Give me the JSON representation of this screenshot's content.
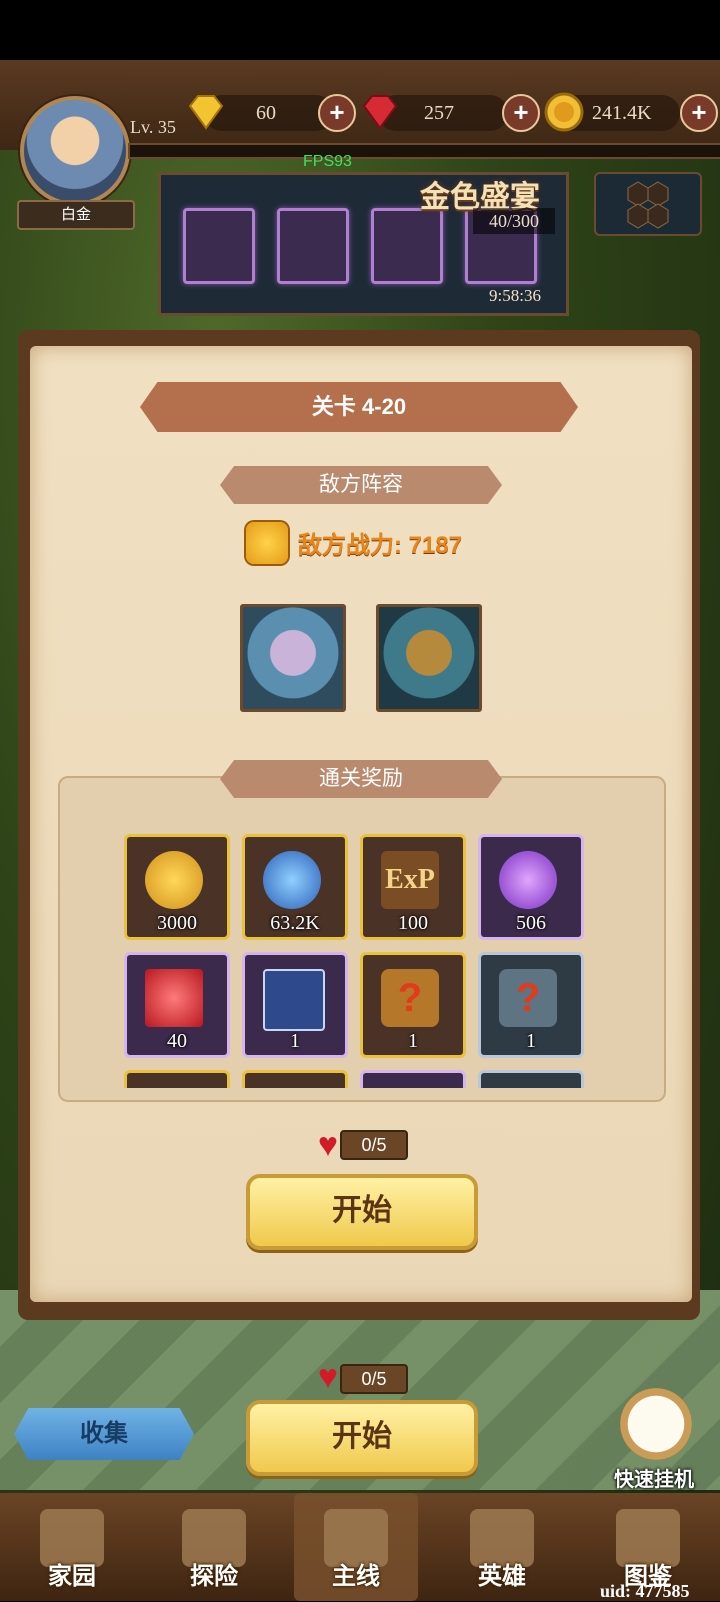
{
  "player": {
    "level": "Lv. 35",
    "rank": "白金"
  },
  "resources": [
    {
      "icon": "yellow-gem-icon",
      "value": "60"
    },
    {
      "icon": "red-gem-icon",
      "value": "257"
    },
    {
      "icon": "gold-coin-icon",
      "value": "241.4K"
    }
  ],
  "fps": "FPS93",
  "event": {
    "title": "金色盛宴",
    "count": "40/300",
    "timer": "9:58:36"
  },
  "modal": {
    "stage_title": "关卡 4-20",
    "enemy_section": "敌方阵容",
    "enemy_power": "敌方战力: 7187",
    "reward_section": "通关奖励",
    "rewards": [
      {
        "name": "gold-coin-reward",
        "qty": "3000",
        "color": "#e8b23a"
      },
      {
        "name": "potion-reward",
        "qty": "63.2K",
        "color": "#3d7fd6"
      },
      {
        "name": "exp-reward",
        "qty": "100",
        "color": "#b8862e",
        "text": "ExP"
      },
      {
        "name": "purple-crystal-reward",
        "qty": "506",
        "color": "#9b44d8"
      },
      {
        "name": "red-gem-reward",
        "qty": "40",
        "color": "#d83030"
      },
      {
        "name": "card-reward",
        "qty": "1",
        "color": "#3d5ea6"
      },
      {
        "name": "gold-mystery-shield-reward",
        "qty": "1",
        "color": "#c9852c",
        "text": "?"
      },
      {
        "name": "silver-mystery-shield-reward",
        "qty": "1",
        "color": "#6d8290",
        "text": "?"
      }
    ],
    "stamina": "0/5",
    "start_label": "开始"
  },
  "bottom": {
    "stamina": "0/5",
    "start_label": "开始",
    "collect_label": "收集",
    "quick_idle_label": "快速挂机"
  },
  "nav": [
    {
      "label": "家园",
      "icon": "castle-icon"
    },
    {
      "label": "探险",
      "icon": "mountain-icon"
    },
    {
      "label": "主线",
      "icon": "crossed-swords-icon"
    },
    {
      "label": "英雄",
      "icon": "hero-icon"
    },
    {
      "label": "图鉴",
      "icon": "book-icon"
    }
  ],
  "uid": "uid: 477585"
}
